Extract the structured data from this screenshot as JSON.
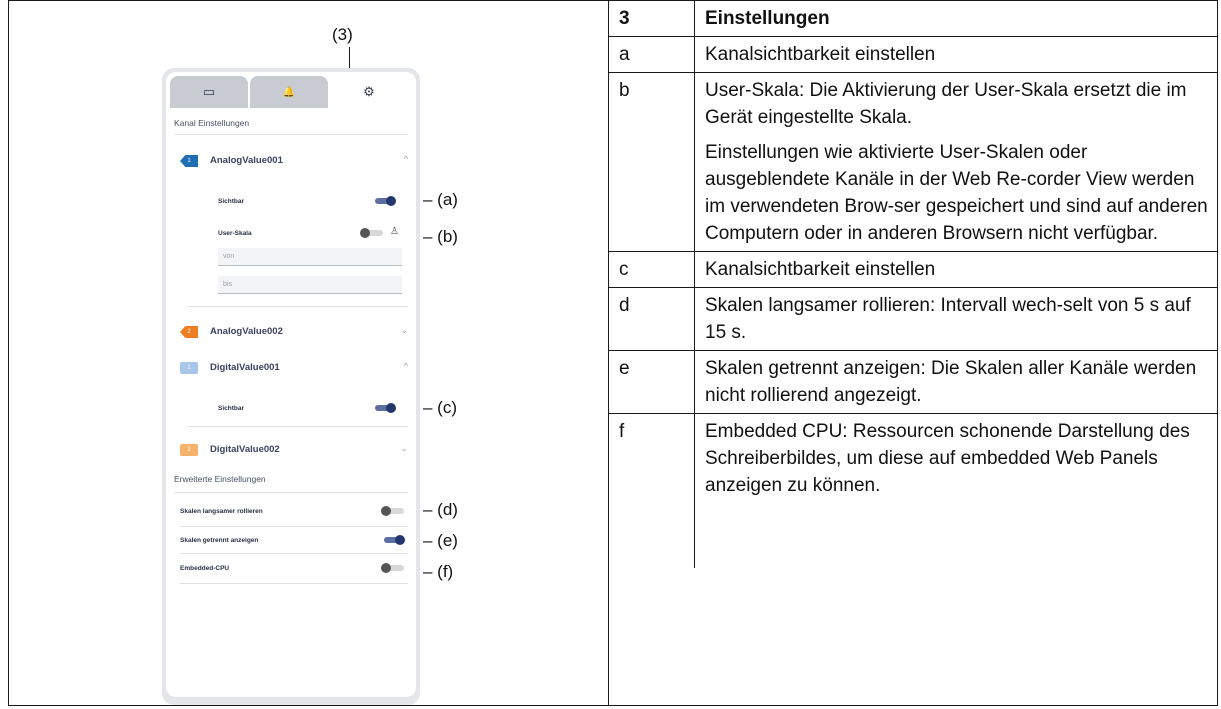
{
  "figure": {
    "callout_main": "(3)",
    "tabs": [
      {
        "icon": "display-icon",
        "glyph": "▭"
      },
      {
        "icon": "bell-icon",
        "glyph": "🔔"
      },
      {
        "icon": "gear-icon",
        "glyph": "⚙"
      }
    ],
    "section_channels": "Kanal Einstellungen",
    "channels": [
      {
        "tag": "1",
        "name": "AnalogValue001",
        "color": "#1f6fb5",
        "chevron": "^"
      },
      {
        "tag": "2",
        "name": "AnalogValue002",
        "color": "#ef7d22",
        "chevron": "⌄"
      },
      {
        "tag": "1",
        "name": "DigitalValue001",
        "color": "#a7c6ea",
        "chevron": "^"
      },
      {
        "tag": "2",
        "name": "DigitalValue002",
        "color": "#f6b26b",
        "chevron": "⌄"
      }
    ],
    "sichtbar_label": "Sichtbar",
    "userskala_label": "User-Skala",
    "von_placeholder": "von",
    "bis_placeholder": "bis",
    "section_advanced": "Erweiterte Einstellungen",
    "advanced": [
      {
        "label": "Skalen langsamer rollieren",
        "on": false
      },
      {
        "label": "Skalen getrennt anzeigen",
        "on": true
      },
      {
        "label": "Embedded-CPU",
        "on": false
      }
    ],
    "callouts": [
      "– (a)",
      "– (b)",
      "– (c)",
      "– (d)",
      "– (e)",
      "– (f)"
    ]
  },
  "table": {
    "header": {
      "key": "3",
      "value": "Einstellungen"
    },
    "rows": [
      {
        "key": "a",
        "text": [
          "Kanalsichtbarkeit einstellen"
        ]
      },
      {
        "key": "b",
        "text": [
          "User-Skala: Die Aktivierung der User-Skala ersetzt die im Gerät eingestellte Skala.",
          "Einstellungen wie aktivierte User-Skalen oder ausgeblendete Kanäle in der Web Re-corder View werden im verwendeten Brow-ser gespeichert und sind auf anderen Computern oder in anderen Browsern nicht verfügbar."
        ]
      },
      {
        "key": "c",
        "text": [
          "Kanalsichtbarkeit einstellen"
        ]
      },
      {
        "key": "d",
        "text": [
          "Skalen langsamer rollieren: Intervall wech-selt von 5 s auf 15 s."
        ]
      },
      {
        "key": "e",
        "text": [
          "Skalen getrennt anzeigen: Die Skalen aller Kanäle werden nicht rollierend angezeigt."
        ]
      },
      {
        "key": "f",
        "text": [
          "Embedded CPU: Ressourcen schonende Darstellung des Schreiberbildes, um diese auf embedded Web Panels anzeigen zu können."
        ]
      }
    ]
  }
}
